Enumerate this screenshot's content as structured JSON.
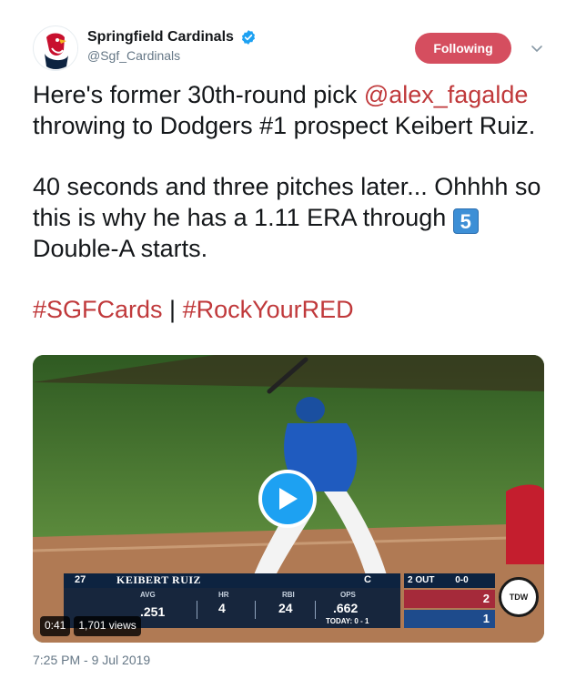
{
  "account": {
    "display_name": "Springfield Cardinals",
    "handle": "@Sgf_Cardinals",
    "avatar_icon": "cardinal-logo-icon",
    "verified_icon": "verified-badge-icon"
  },
  "follow_button": {
    "label": "Following",
    "color": "#d54e5f"
  },
  "menu_icon": "chevron-down-icon",
  "tweet": {
    "line1_pre": "Here's former 30th-round pick ",
    "mention": "@alex_fagalde",
    "line1_post": " throwing to Dodgers #1 prospect Keibert Ruiz.",
    "para2_pre": "40 seconds and three pitches later... Ohhhh so this is why he has a 1.11 ERA through ",
    "keycap": "5",
    "para2_post": " Double-A starts.",
    "hashtag1": "#SGFCards",
    "separator": " | ",
    "hashtag2": "#RockYourRED",
    "link_color": "#c0393b"
  },
  "video": {
    "duration": "0:41",
    "views": "1,701 views",
    "scorebug": {
      "number": "27",
      "player": "KEIBERT RUIZ",
      "position": "C",
      "labels": [
        "AVG",
        "HR",
        "RBI",
        "OPS"
      ],
      "values": [
        ".251",
        "4",
        "24",
        ".662"
      ],
      "today": "TODAY: 0 - 1",
      "outs": "2 OUT",
      "count": "0-0",
      "score_home": "2",
      "score_away": "1",
      "tdw_label": "TDW"
    }
  },
  "timestamp": "7:25 PM - 9 Jul 2019"
}
